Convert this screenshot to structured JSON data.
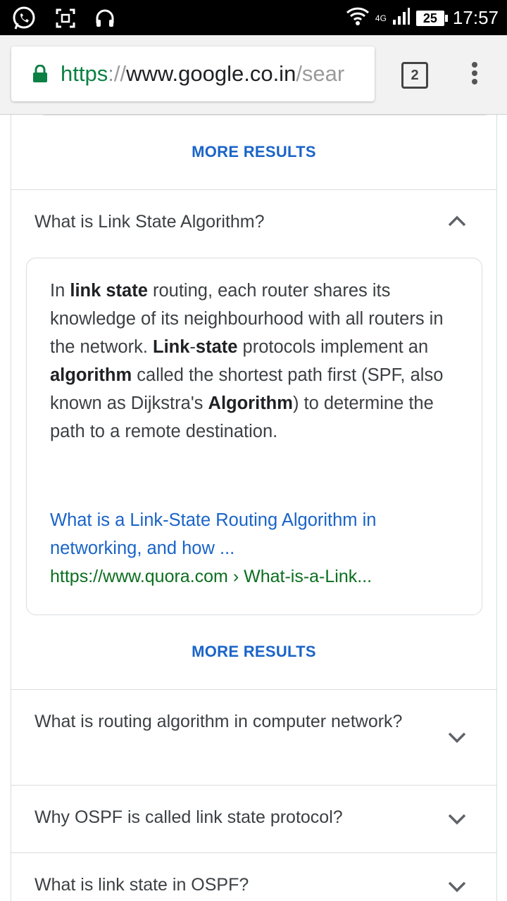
{
  "status_bar": {
    "time": "17:57",
    "battery": "25",
    "network": "4G",
    "icons": [
      "whatsapp-icon",
      "screenshot-icon",
      "headphones-icon",
      "wifi-icon",
      "signal-icon",
      "battery-icon"
    ]
  },
  "browser": {
    "url_scheme": "https",
    "url_sep": "://",
    "url_host": "www.google.co.in",
    "url_path": "/sear",
    "tab_count": "2"
  },
  "more_results_label": "MORE RESULTS",
  "faq": [
    {
      "question": "What is Link State Algorithm?",
      "expanded": true,
      "answer_parts": [
        {
          "text": "In ",
          "bold": false
        },
        {
          "text": "link state",
          "bold": true
        },
        {
          "text": " routing, each router shares its knowledge of its neighbourhood with all routers in the network. ",
          "bold": false
        },
        {
          "text": "Link",
          "bold": true
        },
        {
          "text": "-",
          "bold": false
        },
        {
          "text": "state",
          "bold": true
        },
        {
          "text": " protocols implement an ",
          "bold": false
        },
        {
          "text": "algorithm",
          "bold": true
        },
        {
          "text": " called the shortest path first (SPF, also known as Dijkstra's ",
          "bold": false
        },
        {
          "text": "Algorithm",
          "bold": true
        },
        {
          "text": ") to determine the path to a remote destination.",
          "bold": false
        }
      ],
      "source_title": "What is a Link-State Routing Algorithm in networking, and how ...",
      "source_url": "https://www.quora.com › What-is-a-Link..."
    },
    {
      "question": "What is routing algorithm in computer network?",
      "expanded": false
    },
    {
      "question": "Why OSPF is called link state protocol?",
      "expanded": false
    },
    {
      "question": "What is link state in OSPF?",
      "expanded": false
    }
  ],
  "colors": {
    "link_blue": "#1a64c8",
    "url_green": "#0b6e1f",
    "lock_green": "#0b8043",
    "text": "#3c4043"
  }
}
